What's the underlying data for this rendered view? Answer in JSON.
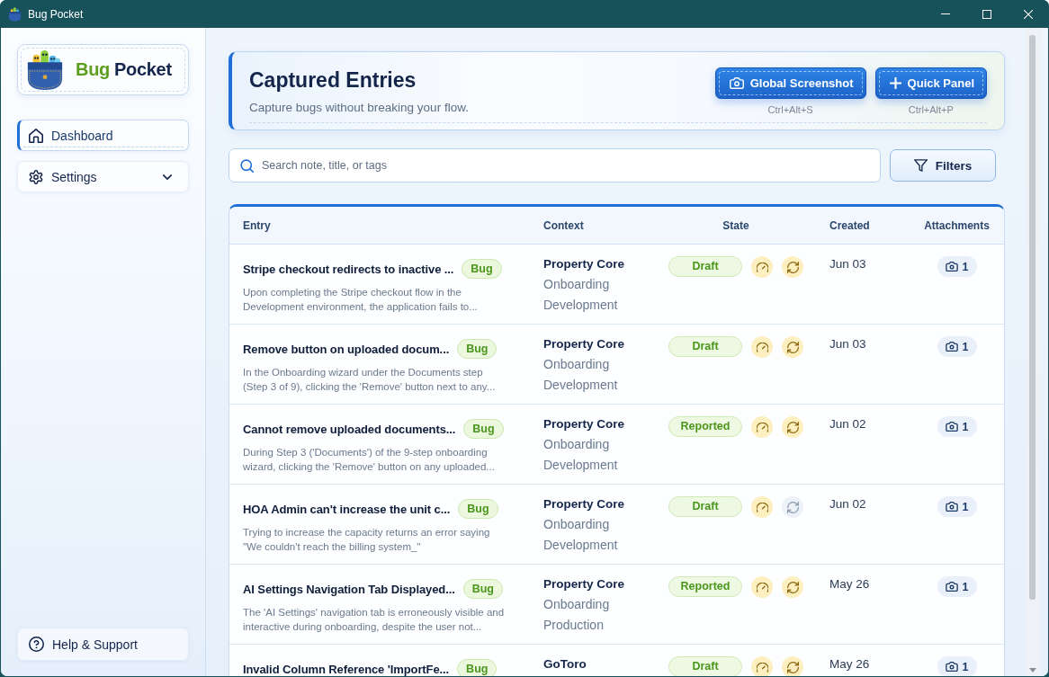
{
  "window": {
    "title": "Bug Pocket"
  },
  "sidebar": {
    "brand": [
      {
        "text": "Bug",
        "color": "#5c9e1e"
      },
      {
        "text": "Pocket",
        "color": "#13254a"
      }
    ],
    "nav": [
      {
        "label": "Dashboard",
        "kind": "link",
        "selected": true
      },
      {
        "label": "Settings",
        "kind": "group",
        "selected": false,
        "expanded": false
      }
    ],
    "footer": {
      "label": "Help & Support"
    }
  },
  "header": {
    "title": "Captured Entries",
    "subtitle": "Capture bugs without breaking your flow.",
    "actions": [
      {
        "label": "Global Screenshot",
        "shortcut": "Ctrl+Alt+S"
      },
      {
        "label": "Quick Panel",
        "shortcut": "Ctrl+Alt+P"
      }
    ]
  },
  "search": {
    "placeholder": "Search note, title, or tags"
  },
  "filters": {
    "label": "Filters"
  },
  "table": {
    "columns": [
      "Entry",
      "Context",
      "State",
      "Created",
      "Attachments"
    ],
    "rows": [
      {
        "title": "Stripe checkout redirects to inactive ...",
        "tag": "Bug",
        "description": "Upon completing the Stripe checkout flow in the Development environment, the application fails to...",
        "context": [
          "Property Core",
          "Onboarding",
          "Development"
        ],
        "state": "Draft",
        "gauge_on": true,
        "sync_on": true,
        "created": "Jun 03",
        "attachments": "1"
      },
      {
        "title": "Remove button on uploaded docum...",
        "tag": "Bug",
        "description": "In the Onboarding wizard under the Documents step (Step 3 of 9), clicking the 'Remove' button next to any...",
        "context": [
          "Property Core",
          "Onboarding",
          "Development"
        ],
        "state": "Draft",
        "gauge_on": true,
        "sync_on": true,
        "created": "Jun 03",
        "attachments": "1"
      },
      {
        "title": "Cannot remove uploaded documents...",
        "tag": "Bug",
        "description": "During Step 3 ('Documents') of the 9-step onboarding wizard, clicking the 'Remove' button on any uploaded...",
        "context": [
          "Property Core",
          "Onboarding",
          "Development"
        ],
        "state": "Reported",
        "gauge_on": true,
        "sync_on": true,
        "created": "Jun 02",
        "attachments": "1"
      },
      {
        "title": "HOA Admin can't increase the unit c...",
        "tag": "Bug",
        "description": "Trying to increase the capacity returns an error saying \"We couldn't reach the billing system_\"",
        "context": [
          "Property Core",
          "Onboarding",
          "Development"
        ],
        "state": "Draft",
        "gauge_on": true,
        "sync_on": false,
        "created": "Jun 02",
        "attachments": "1"
      },
      {
        "title": "AI Settings Navigation Tab Displayed...",
        "tag": "Bug",
        "description": "The 'AI Settings' navigation tab is erroneously visible and interactive during onboarding, despite the user not...",
        "context": [
          "Property Core",
          "Onboarding",
          "Production"
        ],
        "state": "Reported",
        "gauge_on": true,
        "sync_on": true,
        "created": "May 26",
        "attachments": "1"
      },
      {
        "title": "Invalid Column Reference 'ImportFe...",
        "tag": "Bug",
        "context": [
          "GoToro"
        ],
        "state": "Draft",
        "gauge_on": true,
        "sync_on": true,
        "created": "May 26",
        "attachments": "1"
      }
    ]
  }
}
